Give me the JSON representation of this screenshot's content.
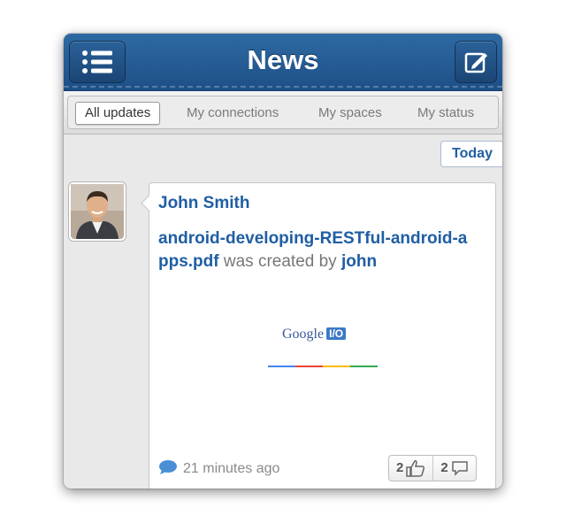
{
  "header": {
    "title": "News",
    "menu_icon": "list-menu-icon",
    "compose_icon": "compose-icon"
  },
  "tabs": [
    {
      "label": "All updates",
      "active": true
    },
    {
      "label": "My connections",
      "active": false
    },
    {
      "label": "My spaces",
      "active": false
    },
    {
      "label": "My status",
      "active": false
    }
  ],
  "date_divider": "Today",
  "post": {
    "author": "John Smith",
    "file_link": "android-developing-RESTful-android-apps.pdf",
    "action_text": " was created by ",
    "creator": "john",
    "preview": {
      "brand": "Google",
      "badge": "I/O"
    },
    "time": "21 minutes ago",
    "likes": "2",
    "comments": "2"
  },
  "colors": {
    "nav_blue": "#1d4f86",
    "link_blue": "#1f5ea3"
  }
}
